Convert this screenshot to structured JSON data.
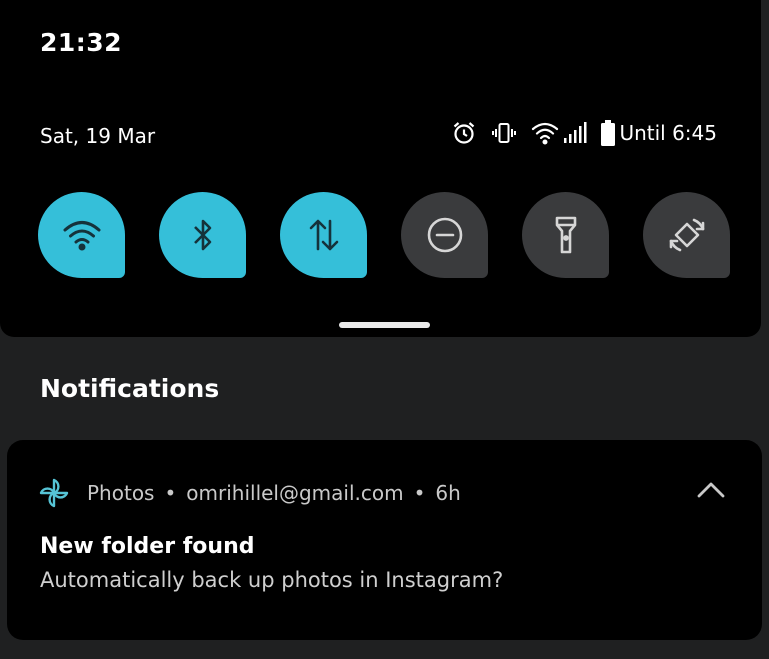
{
  "status_bar": {
    "time": "21:32"
  },
  "quick_settings": {
    "date": "Sat, 19 Mar",
    "battery_text": "Until 6:45",
    "status_icons": [
      "alarm-icon",
      "vibrate-icon",
      "wifi-signal-icon",
      "cell-signal-icon",
      "battery-icon"
    ],
    "tiles": [
      {
        "name": "wifi",
        "icon": "wifi-icon",
        "active": true
      },
      {
        "name": "bluetooth",
        "icon": "bluetooth-icon",
        "active": true
      },
      {
        "name": "mobile-data",
        "icon": "mobile-data-icon",
        "active": true
      },
      {
        "name": "do-not-disturb",
        "icon": "do-not-disturb-icon",
        "active": false
      },
      {
        "name": "flashlight",
        "icon": "flashlight-icon",
        "active": false
      },
      {
        "name": "auto-rotate",
        "icon": "auto-rotate-icon",
        "active": false
      }
    ],
    "accent_color": "#35bfd9"
  },
  "notifications": {
    "heading": "Notifications",
    "items": [
      {
        "app_name": "Photos",
        "account": "omrihillel@gmail.com",
        "time": "6h",
        "title": "New folder found",
        "body": "Automatically back up photos in Instagram?",
        "icon": "photos-pinwheel-icon"
      }
    ]
  }
}
